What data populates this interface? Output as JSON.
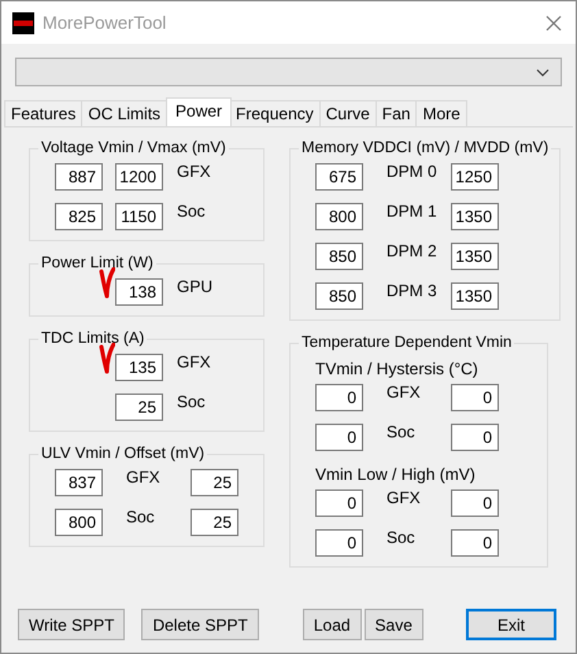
{
  "window": {
    "title": "MorePowerTool"
  },
  "tabs": [
    {
      "label": "Features",
      "selected": false
    },
    {
      "label": "OC Limits",
      "selected": false
    },
    {
      "label": "Power",
      "selected": true
    },
    {
      "label": "Frequency",
      "selected": false
    },
    {
      "label": "Curve",
      "selected": false
    },
    {
      "label": "Fan",
      "selected": false
    },
    {
      "label": "More",
      "selected": false
    }
  ],
  "left_groups": [
    {
      "title": "Voltage Vmin / Vmax (mV)",
      "kind": "after",
      "sections": [
        {
          "rows": [
            {
              "label": "GFX",
              "fields": [
                "887",
                "1200"
              ],
              "annotated": false
            },
            {
              "label": "Soc",
              "fields": [
                "825",
                "1150"
              ],
              "annotated": false
            }
          ]
        }
      ]
    },
    {
      "title": "Power Limit (W)",
      "kind": "after",
      "sections": [
        {
          "rows": [
            {
              "label": "GPU",
              "fields": [
                "138"
              ],
              "annotated": true
            }
          ]
        }
      ]
    },
    {
      "title": "TDC Limits (A)",
      "kind": "after",
      "sections": [
        {
          "rows": [
            {
              "label": "GFX",
              "fields": [
                "135"
              ],
              "annotated": true
            },
            {
              "label": "Soc",
              "fields": [
                "25"
              ],
              "annotated": false
            }
          ]
        }
      ]
    },
    {
      "title": "ULV Vmin / Offset (mV)",
      "kind": "between",
      "sections": [
        {
          "rows": [
            {
              "label": "GFX",
              "fields": [
                "837",
                "25"
              ],
              "annotated": false
            },
            {
              "label": "Soc",
              "fields": [
                "800",
                "25"
              ],
              "annotated": false
            }
          ]
        }
      ]
    }
  ],
  "right_groups": [
    {
      "title": "Memory VDDCI (mV) / MVDD (mV)",
      "kind": "between",
      "sections": [
        {
          "rows": [
            {
              "label": "DPM 0",
              "fields": [
                "675",
                "1250"
              ],
              "annotated": false
            },
            {
              "label": "DPM 1",
              "fields": [
                "800",
                "1350"
              ],
              "annotated": false
            },
            {
              "label": "DPM 2",
              "fields": [
                "850",
                "1350"
              ],
              "annotated": false
            },
            {
              "label": "DPM 3",
              "fields": [
                "850",
                "1350"
              ],
              "annotated": false
            }
          ]
        }
      ]
    },
    {
      "title": "Temperature Dependent Vmin",
      "kind": "between",
      "sections": [
        {
          "subtitle": "TVmin / Hystersis (°C)",
          "rows": [
            {
              "label": "GFX",
              "fields": [
                "0",
                "0"
              ],
              "annotated": false
            },
            {
              "label": "Soc",
              "fields": [
                "0",
                "0"
              ],
              "annotated": false
            }
          ]
        },
        {
          "subtitle": "Vmin Low / High (mV)",
          "rows": [
            {
              "label": "GFX",
              "fields": [
                "0",
                "0"
              ],
              "annotated": false
            },
            {
              "label": "Soc",
              "fields": [
                "0",
                "0"
              ],
              "annotated": false
            }
          ]
        }
      ]
    }
  ],
  "buttons": [
    {
      "label": "Write SPPT",
      "default": false
    },
    {
      "label": "Delete SPPT",
      "default": false
    },
    {
      "label": "Load",
      "default": false
    },
    {
      "label": "Save",
      "default": false
    },
    {
      "label": "Exit",
      "default": true
    }
  ]
}
